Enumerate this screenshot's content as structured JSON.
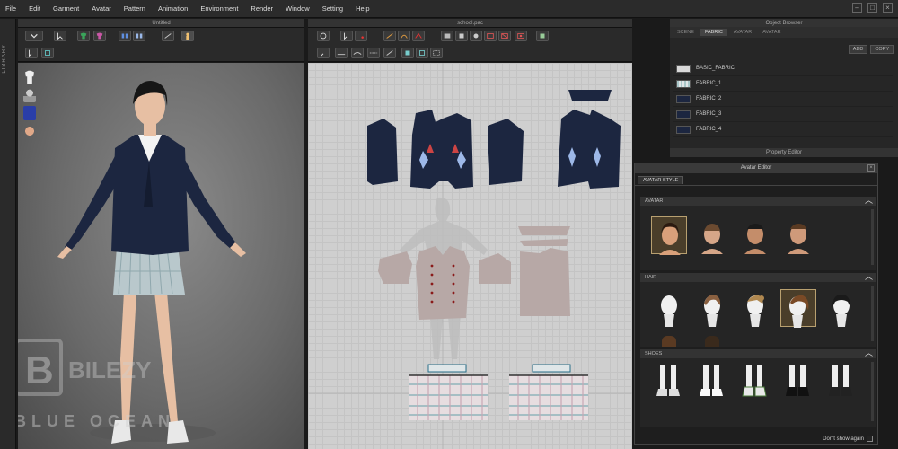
{
  "menu": [
    "File",
    "Edit",
    "Garment",
    "Avatar",
    "Pattern",
    "Animation",
    "Environment",
    "Render",
    "Window",
    "Setting",
    "Help"
  ],
  "panels": {
    "view3d_title": "Untitled",
    "view2d_title": "school.pac",
    "library_label": "LIBRARY",
    "object_browser_title": "Object Browser",
    "property_editor_title": "Property Editor"
  },
  "object_browser": {
    "tabs": [
      "SCENE",
      "FABRIC",
      "AVATAR",
      "AVATAR"
    ],
    "active_tab": "FABRIC",
    "add_label": "ADD",
    "copy_label": "COPY",
    "fabrics": [
      {
        "name": "BASIC_FABRIC",
        "color": "#d9d9d9"
      },
      {
        "name": "FABRIC_1",
        "color": "#a9c7c9"
      },
      {
        "name": "FABRIC_2",
        "color": "#1c2640"
      },
      {
        "name": "FABRIC_3",
        "color": "#1c2640"
      },
      {
        "name": "FABRIC_4",
        "color": "#1c2640"
      }
    ]
  },
  "avatar_editor": {
    "title": "Avatar Editor",
    "tab": "AVATAR STYLE",
    "sections": {
      "avatar": "AVATAR",
      "hair": "HAIR",
      "shoes": "SHOES"
    },
    "dont_show_again": "Don't show again"
  },
  "colors": {
    "jacket": "#1c2640",
    "pleat_skirt": "#b9c8cc",
    "lining": "#b7a8a6",
    "accent_select": "#b8a070"
  },
  "watermark": {
    "brand": "BILEZY",
    "sub": "BLUE OCEAN"
  }
}
